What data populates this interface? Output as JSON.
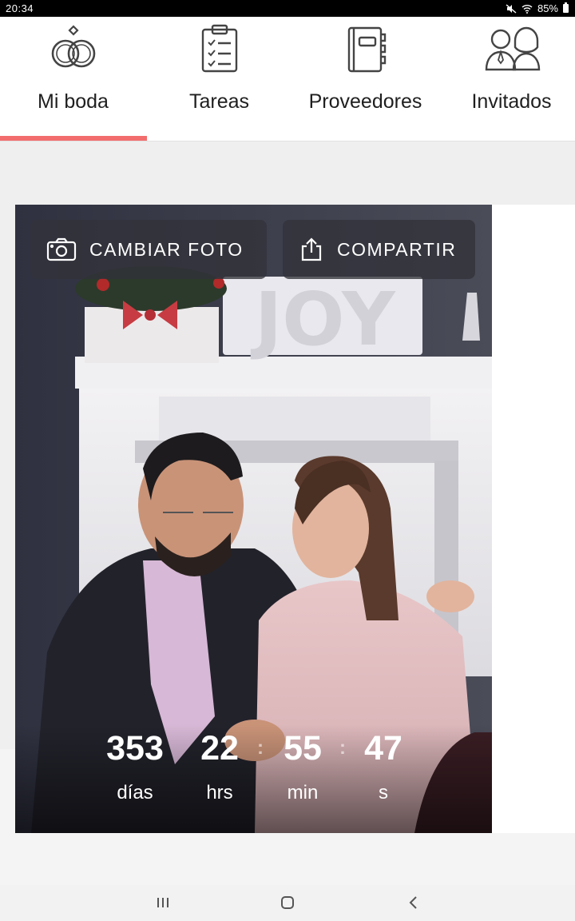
{
  "status_bar": {
    "time": "20:34",
    "battery": "85%"
  },
  "tabs": [
    {
      "label": "Mi boda",
      "icon": "rings-icon",
      "active": true
    },
    {
      "label": "Tareas",
      "icon": "checklist-icon",
      "active": false
    },
    {
      "label": "Proveedores",
      "icon": "notebook-icon",
      "active": false
    },
    {
      "label": "Invitados",
      "icon": "guests-icon",
      "active": false
    }
  ],
  "colors": {
    "accent": "#f26d6d",
    "overlay_button": "rgba(50, 50, 58, 0.78)"
  },
  "photo": {
    "change_photo_label": "CAMBIAR FOTO",
    "share_label": "COMPARTIR"
  },
  "countdown": {
    "days": {
      "value": "353",
      "label": "días"
    },
    "hours": {
      "value": "22",
      "label": "hrs"
    },
    "minutes": {
      "value": "55",
      "label": "min"
    },
    "seconds": {
      "value": "47",
      "label": "s"
    }
  },
  "android_nav": {
    "recents": "recents-icon",
    "home": "home-icon",
    "back": "back-icon"
  }
}
